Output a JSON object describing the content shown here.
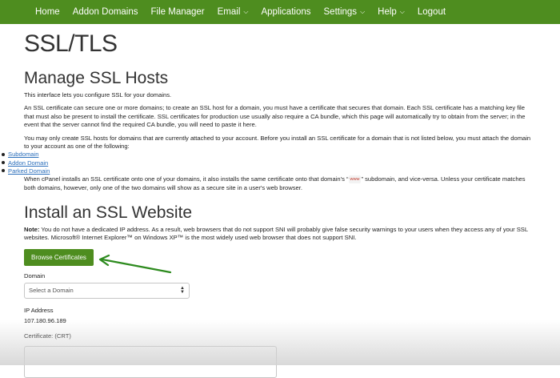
{
  "nav": {
    "items": [
      {
        "label": "Home",
        "dropdown": false
      },
      {
        "label": "Addon Domains",
        "dropdown": false
      },
      {
        "label": "File Manager",
        "dropdown": false
      },
      {
        "label": "Email",
        "dropdown": true
      },
      {
        "label": "Applications",
        "dropdown": false
      },
      {
        "label": "Settings",
        "dropdown": true
      },
      {
        "label": "Help",
        "dropdown": true
      },
      {
        "label": "Logout",
        "dropdown": false
      }
    ],
    "bg_color": "#4e8d1f"
  },
  "page": {
    "title": "SSL/TLS"
  },
  "manage": {
    "heading": "Manage SSL Hosts",
    "intro": "This interface lets you configure SSL for your domains.",
    "para1": "An SSL certificate can secure one or more domains; to create an SSL host for a domain, you must have a certificate that secures that domain. Each SSL certificate has a matching key file that must also be present to install the certificate. SSL certificates for production use usually also require a CA bundle, which this page will automatically try to obtain from the server; in the event that the server cannot find the required CA bundle, you will need to paste it here.",
    "para2": "You may only create SSL hosts for domains that are currently attached to your account. Before you install an SSL certificate for a domain that is not listed below, you must attach the domain to your account as one of the following:",
    "links": [
      "Subdomain",
      "Addon Domain",
      "Parked Domain"
    ],
    "para3_start": "When cPanel installs an SSL certificate onto one of your domains, it also installs the same certificate onto that domain's “",
    "para3_badge": "www",
    "para3_end": "” subdomain, and vice-versa. Unless your certificate matches both domains, however, only one of the two domains will show as a secure site in a user's web browser."
  },
  "install": {
    "heading": "Install an SSL Website",
    "note_label": "Note:",
    "note_text": "You do not have a dedicated IP address. As a result, web browsers that do not support SNI will probably give false security warnings to your users when they access any of your SSL websites. Microsoft® Internet Explorer™ on Windows XP™ is the most widely used web browser that does not support SNI.",
    "browse_button": "Browse Certificates",
    "domain_label": "Domain",
    "domain_select": "Select a Domain",
    "ip_label": "IP Address",
    "ip_value": "107.180.96.189",
    "cert_label": "Certificate: (CRT)"
  },
  "colors": {
    "accent": "#4e8d1f",
    "arrow": "#2e8b1f",
    "link": "#2a6ebb"
  }
}
